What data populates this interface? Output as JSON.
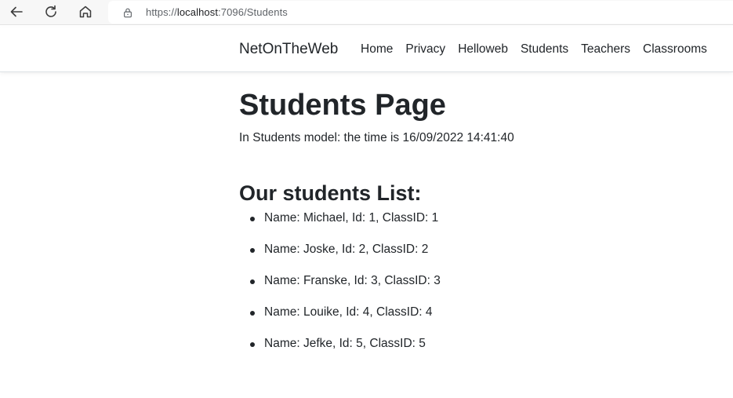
{
  "browser": {
    "url_prefix": "https://",
    "url_host": "localhost",
    "url_rest": ":7096/Students",
    "icons": [
      "back-arrow-icon",
      "reload-icon",
      "home-icon",
      "lock-icon"
    ]
  },
  "navbar": {
    "brand": "NetOnTheWeb",
    "links": [
      "Home",
      "Privacy",
      "Helloweb",
      "Students",
      "Teachers",
      "Classrooms"
    ]
  },
  "main": {
    "title": "Students Page",
    "time_line": "In Students model: the time is 16/09/2022 14:41:40",
    "list_heading": "Our students List:",
    "students": [
      "Name: Michael, Id: 1, ClassID: 1",
      "Name: Joske, Id: 2, ClassID: 2",
      "Name: Franske, Id: 3, ClassID: 3",
      "Name: Louike, Id: 4, ClassID: 4",
      "Name: Jefke, Id: 5, ClassID: 5"
    ]
  }
}
